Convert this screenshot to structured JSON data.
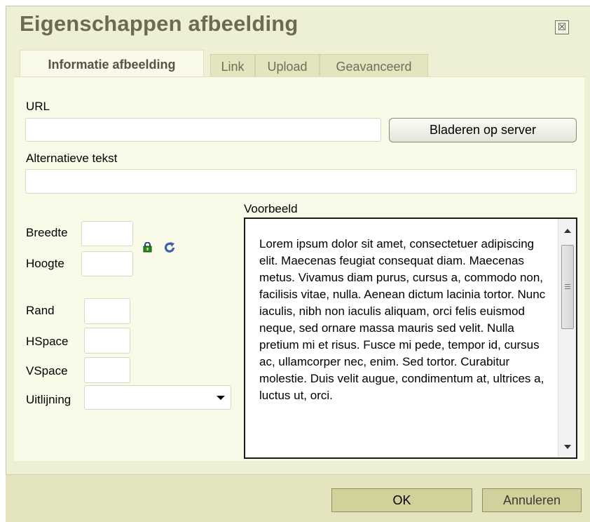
{
  "dialog": {
    "title": "Eigenschappen afbeelding",
    "close_symbol": "☒"
  },
  "tabs": [
    {
      "label": "Informatie afbeelding",
      "active": true
    },
    {
      "label": "Link",
      "active": false
    },
    {
      "label": "Upload",
      "active": false
    },
    {
      "label": "Geavanceerd",
      "active": false
    }
  ],
  "form": {
    "url_label": "URL",
    "url_value": "",
    "browse_button": "Bladeren op server",
    "alt_label": "Alternatieve tekst",
    "alt_value": "",
    "width_label": "Breedte",
    "height_label": "Hoogte",
    "border_label": "Rand",
    "hspace_label": "HSpace",
    "vspace_label": "VSpace",
    "align_label": "Uitlijning",
    "align_value": "",
    "icons": [
      "lock-icon",
      "reset-size-icon"
    ]
  },
  "preview": {
    "label": "Voorbeeld",
    "text": "Lorem ipsum dolor sit amet, consectetuer adipiscing elit. Maecenas feugiat consequat diam. Maecenas metus. Vivamus diam purus, cursus a, commodo non, facilisis vitae, nulla. Aenean dictum lacinia tortor. Nunc iaculis, nibh non iaculis aliquam, orci felis euismod neque, sed ornare massa mauris sed velit. Nulla pretium mi et risus. Fusce mi pede, tempor id, cursus ac, ullamcorper nec, enim. Sed tortor. Curabitur molestie. Duis velit augue, condimentum at, ultrices a, luctus ut, orci."
  },
  "footer": {
    "ok_button": "OK",
    "cancel_button": "Annuleren"
  },
  "colors": {
    "dialog_bg": "#eef0d6",
    "panel_bg": "#fafae8",
    "title_color": "#6b6b50",
    "button_bg": "#d2d19b"
  }
}
